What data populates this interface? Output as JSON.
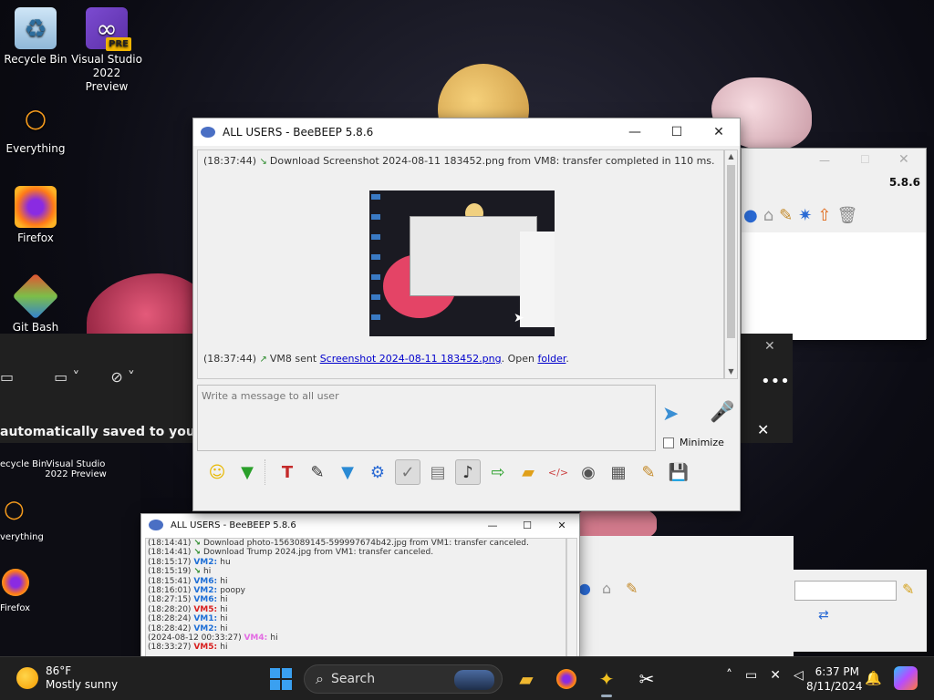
{
  "desktop": {
    "icons": [
      {
        "label": "Recycle Bin",
        "icon": "recycle-bin-icon"
      },
      {
        "label": "Visual Studio 2022 Preview",
        "icon": "visual-studio-icon",
        "badge": "PRE"
      },
      {
        "label": "Everything",
        "icon": "everything-search-icon"
      },
      {
        "label": "Firefox",
        "icon": "firefox-icon"
      },
      {
        "label": "Git Bash",
        "icon": "git-bash-icon"
      }
    ],
    "lower_icons": [
      {
        "label": "ecycle Bin"
      },
      {
        "label": "Visual Studio 2022 Preview"
      },
      {
        "label": "verything"
      },
      {
        "label": "Firefox"
      }
    ]
  },
  "main_window": {
    "title": "ALL USERS - BeeBEEP 5.8.6",
    "chat": {
      "line1_time": "(18:37:44)",
      "line1_text": "Download Screenshot 2024-08-11 183452.png from VM8: transfer completed in 110 ms.",
      "line2_time": "(18:37:44)",
      "line2_sender": "VM8 sent",
      "line2_link": "Screenshot 2024-08-11 183452.png",
      "line2_mid": ". Open",
      "line2_folder": "folder",
      "line2_end": "."
    },
    "input_placeholder": "Write a message to all user",
    "minimize_label": "Minimize"
  },
  "right_window": {
    "version": "5.8.6"
  },
  "snip_panel": {
    "message": "automatically saved to your Scree"
  },
  "small_window": {
    "title": "ALL USERS - BeeBEEP 5.8.6",
    "lines": [
      {
        "time": "(18:14:41)",
        "user": "",
        "text": "Download photo-1563089145-599997674b42.jpg from VM1: transfer canceled.",
        "color": ""
      },
      {
        "time": "(18:14:41)",
        "user": "",
        "text": "Download Trump 2024.jpg from VM1: transfer canceled.",
        "color": ""
      },
      {
        "time": "(18:15:17)",
        "user": "VM2:",
        "text": "hu",
        "color": "blue"
      },
      {
        "time": "(18:15:19)",
        "user": "",
        "text": "hi",
        "color": ""
      },
      {
        "time": "(18:15:41)",
        "user": "VM6:",
        "text": "hi",
        "color": "blue"
      },
      {
        "time": "(18:16:01)",
        "user": "VM2:",
        "text": "poopy",
        "color": "blue"
      },
      {
        "time": "(18:27:15)",
        "user": "VM6:",
        "text": "hi",
        "color": "blue"
      },
      {
        "time": "(18:28:20)",
        "user": "VM5:",
        "text": "hi",
        "color": "red"
      },
      {
        "time": "(18:28:24)",
        "user": "VM1:",
        "text": "hi",
        "color": "blue"
      },
      {
        "time": "(18:28:42)",
        "user": "VM2:",
        "text": "hi",
        "color": "blue"
      },
      {
        "time": "(2024-08-12 00:33:27)",
        "user": "VM4:",
        "text": "hi",
        "color": "pink"
      },
      {
        "time": "(18:33:27)",
        "user": "VM5:",
        "text": "hi",
        "color": "red"
      }
    ]
  },
  "taskbar": {
    "weather_temp": "86°F",
    "weather_desc": "Mostly sunny",
    "search_label": "Search",
    "time": "6:37 PM",
    "date": "8/11/2024"
  },
  "colors": {
    "link": "#0000cc",
    "taskbar": "#202020",
    "accent": "#3aa0f0"
  }
}
